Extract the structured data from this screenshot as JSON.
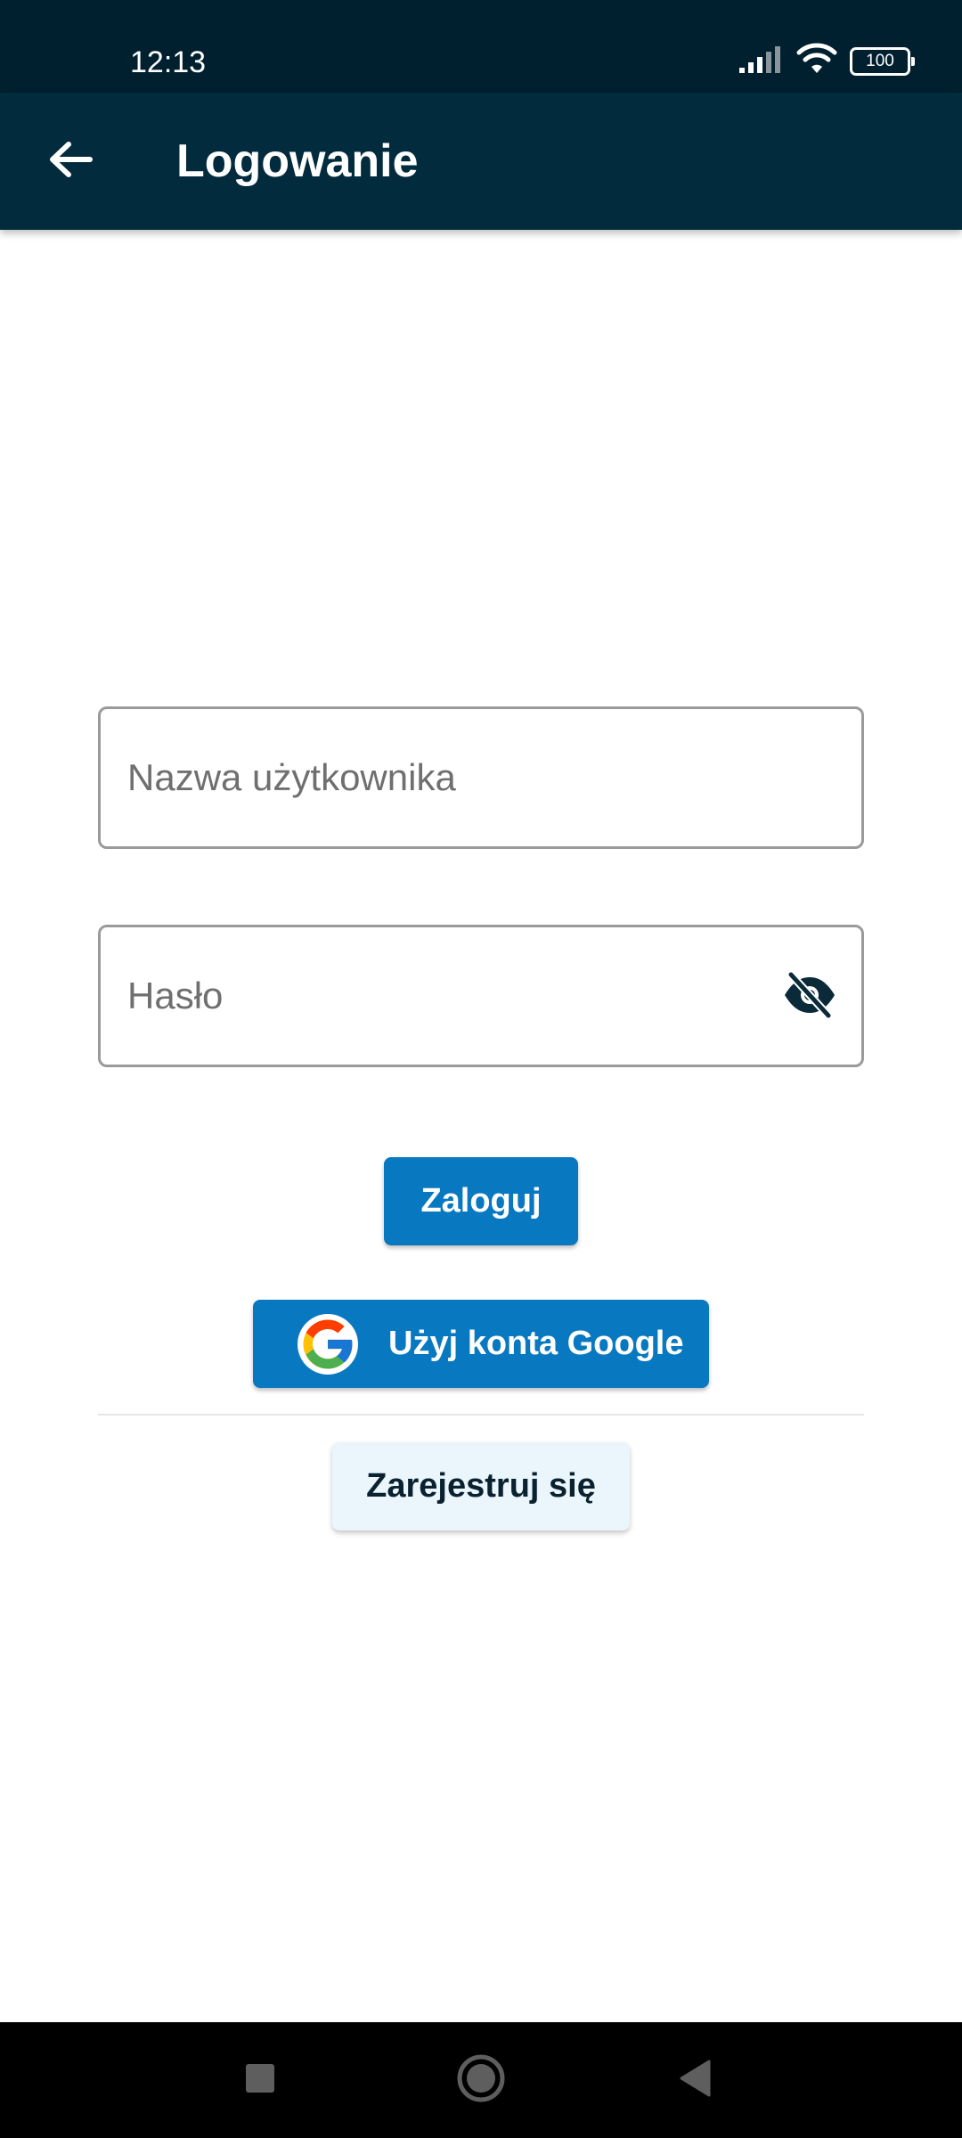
{
  "status_bar": {
    "time": "12:13",
    "battery": "100",
    "icons": [
      "signal-icon",
      "wifi-icon",
      "battery-icon"
    ]
  },
  "app_bar": {
    "title": "Logowanie",
    "back_icon": "arrow-left-icon"
  },
  "form": {
    "username": {
      "placeholder": "Nazwa użytkownika",
      "value": ""
    },
    "password": {
      "placeholder": "Hasło",
      "value": "",
      "toggle_icon": "eye-off-icon"
    }
  },
  "buttons": {
    "login": "Zaloguj",
    "google": "Użyj konta Google",
    "register": "Zarejestruj się"
  },
  "nav_bar": {
    "icons": [
      "square-icon",
      "circle-icon",
      "triangle-back-icon"
    ]
  },
  "colors": {
    "status_bar": "#01202f",
    "app_bar": "#022b3d",
    "primary_button": "#0879c0",
    "secondary_button": "#eaf5fc",
    "field_border": "#9a9a9a"
  }
}
